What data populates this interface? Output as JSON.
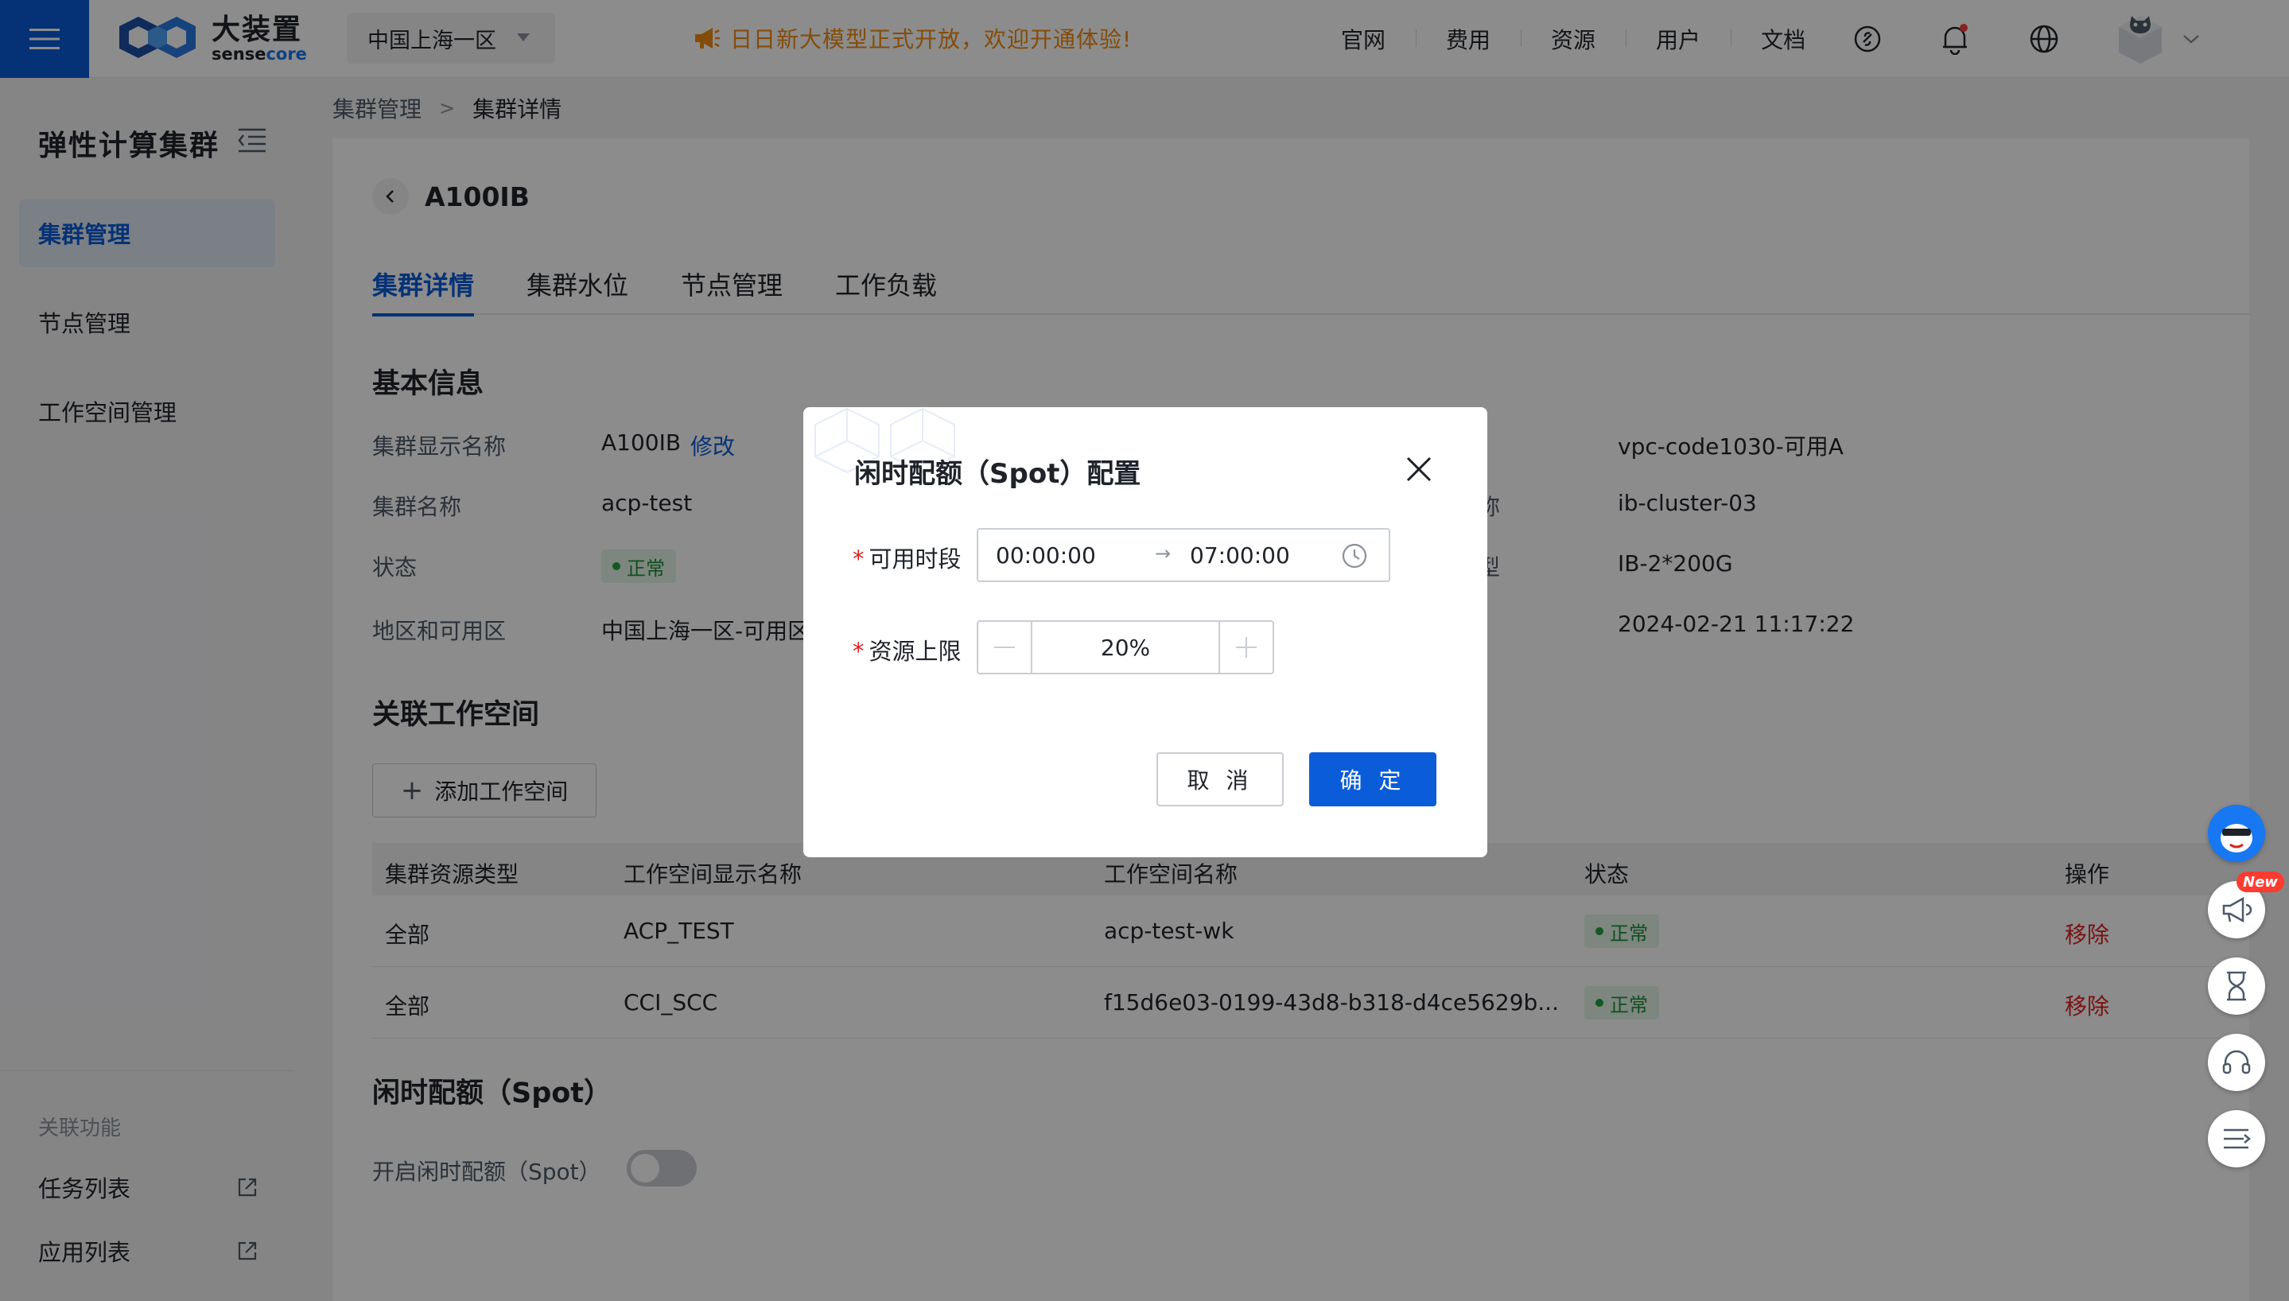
{
  "topbar": {
    "brand_cn": "大装置",
    "brand_en_main": "sense",
    "brand_en_accent": "core",
    "region": "中国上海一区",
    "announcement": "日日新大模型正式开放，欢迎开通体验!",
    "nav": [
      "官网",
      "费用",
      "资源",
      "用户",
      "文档"
    ]
  },
  "sidebar": {
    "title": "弹性计算集群",
    "items": [
      {
        "label": "集群管理",
        "active": true
      },
      {
        "label": "节点管理",
        "active": false
      },
      {
        "label": "工作空间管理",
        "active": false
      }
    ],
    "related_title": "关联功能",
    "related_links": [
      "任务列表",
      "应用列表"
    ]
  },
  "breadcrumb": {
    "parent": "集群管理",
    "current": "集群详情"
  },
  "detail": {
    "title": "A100IB",
    "tabs": [
      "集群详情",
      "集群水位",
      "节点管理",
      "工作负载"
    ],
    "active_tab": 0,
    "basic_info_title": "基本信息",
    "basic_info": {
      "display_name_label": "集群显示名称",
      "display_name_value": "A100IB",
      "edit_label": "修改",
      "name_label": "集群名称",
      "name_value": "acp-test",
      "status_label": "状态",
      "status_value": "正常",
      "region_label": "地区和可用区",
      "region_value": "中国上海一区-可用区",
      "right_label_partial_1": "称",
      "right_label_partial_2": "型",
      "vpc_value": "vpc-code1030-可用A",
      "ib_cluster_value": "ib-cluster-03",
      "ib_type_value": "IB-2*200G",
      "created_value": "2024-02-21 11:17:22"
    },
    "workspace_title": "关联工作空间",
    "add_workspace_label": "添加工作空间",
    "table": {
      "headers": [
        "集群资源类型",
        "工作空间显示名称",
        "工作空间名称",
        "状态",
        "操作"
      ],
      "rows": [
        {
          "type": "全部",
          "display_name": "ACP_TEST",
          "name": "acp-test-wk",
          "status": "正常",
          "action": "移除"
        },
        {
          "type": "全部",
          "display_name": "CCI_SCC",
          "name": "f15d6e03-0199-43d8-b318-d4ce5629b...",
          "status": "正常",
          "action": "移除"
        }
      ]
    },
    "spot_title": "闲时配额（Spot）",
    "spot_toggle_label": "开启闲时配额（Spot）",
    "spot_enabled": false
  },
  "modal": {
    "title": "闲时配额（Spot）配置",
    "period_label": "可用时段",
    "period_start": "00:00:00",
    "period_end": "07:00:00",
    "limit_label": "资源上限",
    "limit_value": "20%",
    "cancel_label": "取 消",
    "ok_label": "确 定"
  },
  "floating": {
    "new_badge": "New"
  },
  "colors": {
    "primary": "#0a5cd8",
    "announcement": "#f08a12",
    "danger": "#e02020",
    "success": "#22a33c"
  }
}
